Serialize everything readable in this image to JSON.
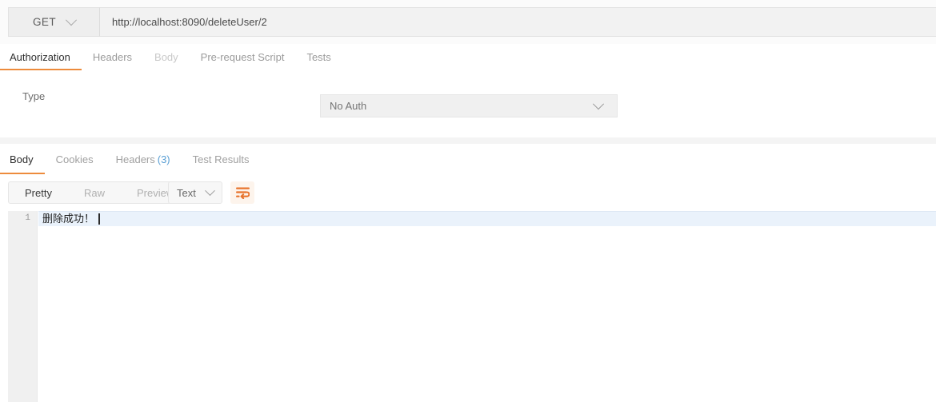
{
  "request_bar": {
    "method": "GET",
    "method_icon": "chevron-down-icon",
    "url": "http://localhost:8090/deleteUser/2",
    "url_placeholder": "Enter request URL"
  },
  "request_tabs": [
    {
      "label": "Authorization",
      "active": true
    },
    {
      "label": "Headers",
      "active": false
    },
    {
      "label": "Body",
      "active": false
    },
    {
      "label": "Pre-request Script",
      "active": false
    },
    {
      "label": "Tests",
      "active": false
    }
  ],
  "auth_pane": {
    "type_label": "Type",
    "type_value": "No Auth",
    "type_icon": "chevron-down-icon"
  },
  "response_tabs": [
    {
      "label": "Body",
      "count": "",
      "active": true
    },
    {
      "label": "Cookies",
      "count": "",
      "active": false
    },
    {
      "label": "Headers",
      "count": "(3)",
      "active": false
    },
    {
      "label": "Test Results",
      "count": "",
      "active": false
    }
  ],
  "body_toolbar": {
    "view_modes": [
      {
        "label": "Pretty",
        "active": true
      },
      {
        "label": "Raw",
        "active": false
      },
      {
        "label": "Preview",
        "active": false
      }
    ],
    "format": "Text",
    "format_icon": "chevron-down-icon",
    "wrap_icon": "word-wrap-icon"
  },
  "response_body": {
    "line_number": "1",
    "text": "删除成功！"
  },
  "colors": {
    "accent_orange": "#ed8b3c",
    "badge_blue": "#5a9fd4",
    "active_line": "#eaf2fb"
  }
}
